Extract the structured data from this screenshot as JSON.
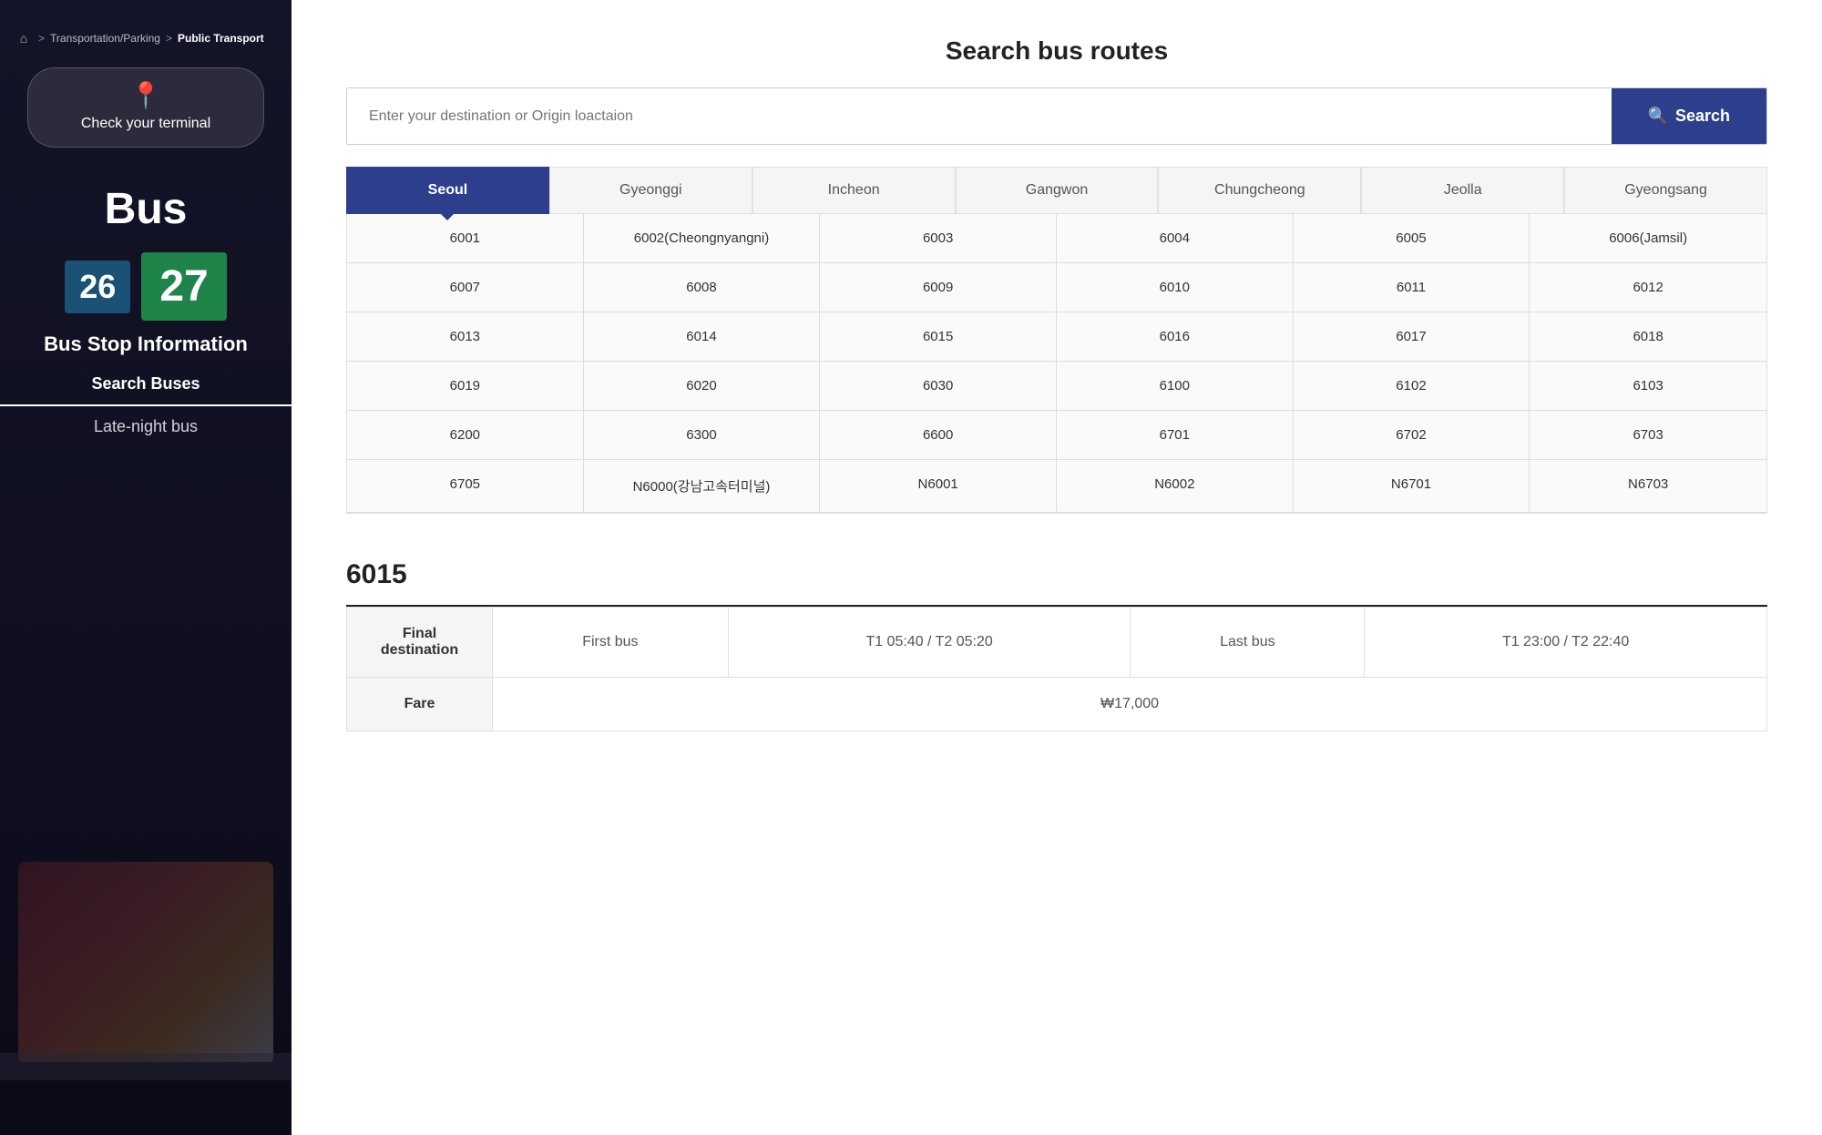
{
  "sidebar": {
    "breadcrumb": {
      "home_label": "🏠",
      "sep1": ">",
      "item1": "Transportation/Parking",
      "sep2": ">",
      "item2": "Public Transport"
    },
    "terminal_button_label": "Check your terminal",
    "bus_title": "Bus",
    "numbers": {
      "small": "26",
      "large": "27"
    },
    "bus_stop_label": "Bus Stop Information",
    "nav_items": [
      {
        "label": "Search Buses",
        "active": true
      },
      {
        "label": "Late-night bus",
        "active": false
      }
    ]
  },
  "main": {
    "page_title": "Search bus routes",
    "search": {
      "placeholder": "Enter your destination or Origin loactaion",
      "button_label": "Search"
    },
    "region_tabs": [
      {
        "label": "Seoul",
        "active": true
      },
      {
        "label": "Gyeonggi",
        "active": false
      },
      {
        "label": "Incheon",
        "active": false
      },
      {
        "label": "Gangwon",
        "active": false
      },
      {
        "label": "Chungcheong",
        "active": false
      },
      {
        "label": "Jeolla",
        "active": false
      },
      {
        "label": "Gyeongsang",
        "active": false
      }
    ],
    "routes": [
      [
        "6001",
        "6002(Cheongnyangni)",
        "6003",
        "6004",
        "6005",
        "6006(Jamsil)"
      ],
      [
        "6007",
        "6008",
        "6009",
        "6010",
        "6011",
        "6012"
      ],
      [
        "6013",
        "6014",
        "6015",
        "6016",
        "6017",
        "6018"
      ],
      [
        "6019",
        "6020",
        "6030",
        "6100",
        "6102",
        "6103"
      ],
      [
        "6200",
        "6300",
        "6600",
        "6701",
        "6702",
        "6703"
      ],
      [
        "6705",
        "N6000(강남고속터미널)",
        "N6001",
        "N6002",
        "N6701",
        "N6703"
      ]
    ],
    "route_detail": {
      "title": "6015",
      "table": {
        "rows": [
          {
            "label": "Final destination",
            "cells": [
              {
                "label": "First bus",
                "value": "T1 05:40 / T2 05:20"
              },
              {
                "label": "Last bus",
                "value": "T1 23:00 / T2 22:40"
              }
            ]
          },
          {
            "label": "Fare",
            "cells": [
              {
                "value": "₩17,000"
              }
            ]
          }
        ]
      }
    }
  }
}
